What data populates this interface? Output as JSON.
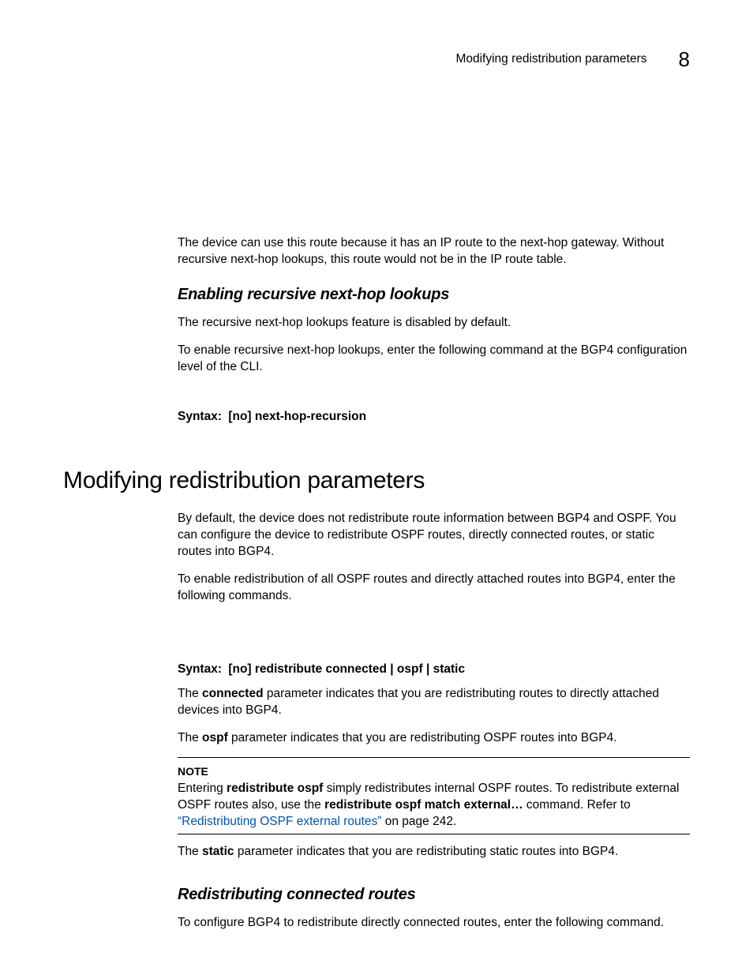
{
  "header": {
    "title": "Modifying redistribution parameters",
    "chapter": "8"
  },
  "intro": {
    "p1": "The device can use this route because it has an IP route to the next-hop gateway. Without recursive next-hop lookups, this route would not be in the IP route table."
  },
  "sec1": {
    "heading": "Enabling recursive next-hop lookups",
    "p1": "The recursive next-hop lookups feature is disabled by default.",
    "p2": "To enable recursive next-hop lookups, enter the following command at the BGP4 configuration level of the CLI.",
    "syntax_label": "Syntax:",
    "syntax_cmd": "[no] next-hop-recursion"
  },
  "h1": "Modifying redistribution parameters",
  "sec2": {
    "p1": "By default, the device does not redistribute route information between BGP4 and OSPF. You can configure the device to redistribute OSPF routes, directly connected routes, or static routes into BGP4.",
    "p2": "To enable redistribution of all OSPF routes and directly attached routes into BGP4, enter the following commands.",
    "syntax_label": "Syntax:",
    "syntax_cmd": "[no] redistribute connected | ospf | static",
    "p3a": "The ",
    "p3b": "connected",
    "p3c": " parameter indicates that you are redistributing routes to directly attached devices into BGP4.",
    "p4a": "The ",
    "p4b": "ospf",
    "p4c": " parameter indicates that you are redistributing OSPF routes into BGP4.",
    "note_label": "NOTE",
    "note_a": "Entering ",
    "note_b": "redistribute ospf",
    "note_c": " simply redistributes internal OSPF routes. To redistribute external OSPF routes also, use the ",
    "note_d": "redistribute ospf match external…",
    "note_e": " command. Refer to ",
    "note_link": "“Redistributing OSPF external routes”",
    "note_f": " on page 242.",
    "p5a": "The ",
    "p5b": "static",
    "p5c": " parameter indicates that you are redistributing static routes into BGP4."
  },
  "sec3": {
    "heading": "Redistributing connected routes",
    "p1": "To configure BGP4 to redistribute directly connected routes, enter the following command."
  }
}
